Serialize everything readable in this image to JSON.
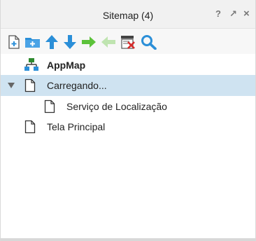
{
  "header": {
    "title": "Sitemap (4)",
    "help_label": "?",
    "popout_label": "↗",
    "close_label": "×"
  },
  "toolbar": {
    "icons": [
      "add-page-icon",
      "add-folder-icon",
      "move-up-icon",
      "move-down-icon",
      "indent-icon",
      "outdent-icon",
      "delete-icon",
      "search-icon"
    ],
    "colors": {
      "blue": "#2b8fd8",
      "green": "#5cc23a",
      "green_disabled": "#bfe4b0",
      "red": "#d62b2b"
    }
  },
  "tree": {
    "items": [
      {
        "label": "AppMap",
        "icon": "sitemap-root-icon"
      },
      {
        "label": "Carregando...",
        "icon": "page-icon",
        "expanded": true,
        "selected": true
      },
      {
        "label": "Serviço de Localização",
        "icon": "page-icon"
      },
      {
        "label": "Tela Principal",
        "icon": "page-icon"
      }
    ],
    "selected_color": "#cfe3f1"
  }
}
